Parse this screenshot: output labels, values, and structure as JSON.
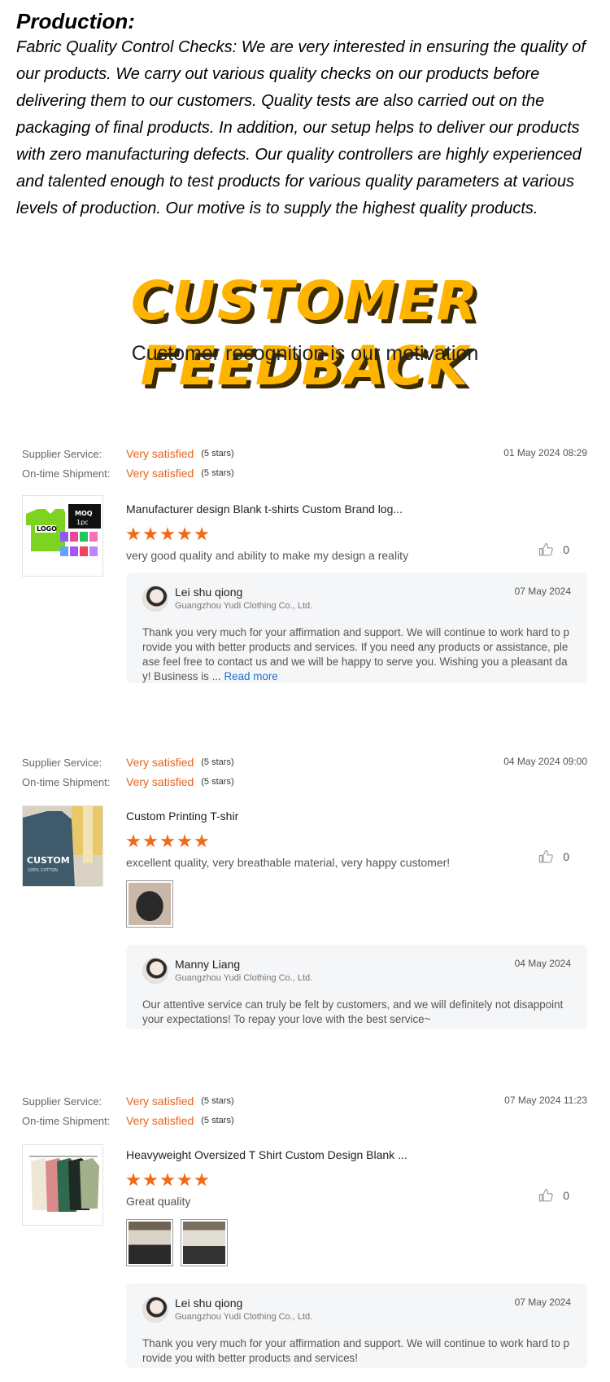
{
  "production": {
    "heading": "Production:",
    "text": "Fabric Quality Control Checks: We are very interested in ensuring the quality of our products. We carry out various quality checks on our products before delivering them to our customers. Quality tests are also carried out on the packaging of final products. In addition, our setup helps to deliver our products with zero manufacturing defects. Our quality controllers are highly experienced and talented enough to test products for various quality parameters at various levels of production. Our motive is to supply the highest quality products."
  },
  "banner": {
    "title": "CUSTOMER FEEDBACK",
    "subtitle": "Customer recognition is our motivation",
    "title_color": "#ffb400"
  },
  "labels": {
    "supplier_service": "Supplier Service:",
    "on_time_shipment": "On-time Shipment:",
    "read_more": "Read more"
  },
  "colors": {
    "accent": "#e8641b",
    "star": "#f26a16",
    "link": "#1e6fc7"
  },
  "reviews": [
    {
      "supplier_value": "Very satisfied",
      "supplier_stars": "(5 stars)",
      "shipment_value": "Very satisfied",
      "shipment_stars": "(5 stars)",
      "date": "01 May 2024 08:29",
      "product_title": "Manufacturer design Blank t-shirts Custom Brand log...",
      "rating": 5,
      "comment": "very good quality and ability to make my design a reality",
      "likes": "0",
      "photo_count": 0,
      "reply": {
        "name": "Lei shu qiong",
        "company": "Guangzhou Yudi Clothing Co., Ltd.",
        "date": "07 May 2024",
        "text": "Thank you very much for your affirmation and support. We will continue to work hard to provide you with better products and services. If you need any products or assistance, please feel free to contact us and we will be happy to serve you. Wishing you a pleasant day! Business is ..."
      }
    },
    {
      "supplier_value": "Very satisfied",
      "supplier_stars": "(5 stars)",
      "shipment_value": "Very satisfied",
      "shipment_stars": "(5 stars)",
      "date": "04 May 2024 09:00",
      "product_title": "Custom Printing T-shir",
      "rating": 5,
      "comment": "excellent quality, very breathable material, very happy customer!",
      "likes": "0",
      "photo_count": 1,
      "reply": {
        "name": "Manny Liang",
        "company": "Guangzhou Yudi Clothing Co., Ltd.",
        "date": "04 May 2024",
        "text": "Our attentive service can truly be felt by customers, and we will definitely not disappoint your expectations! To repay your love with the best service~"
      }
    },
    {
      "supplier_value": "Very satisfied",
      "supplier_stars": "(5 stars)",
      "shipment_value": "Very satisfied",
      "shipment_stars": "(5 stars)",
      "date": "07 May 2024 11:23",
      "product_title": "Heavyweight Oversized T Shirt Custom Design Blank ...",
      "rating": 5,
      "comment": "Great quality",
      "likes": "0",
      "photo_count": 2,
      "reply": {
        "name": "Lei shu qiong",
        "company": "Guangzhou Yudi Clothing Co., Ltd.",
        "date": "07 May 2024",
        "text": "Thank you very much for your affirmation and support. We will continue to work hard to provide you with better products and services!"
      }
    }
  ]
}
